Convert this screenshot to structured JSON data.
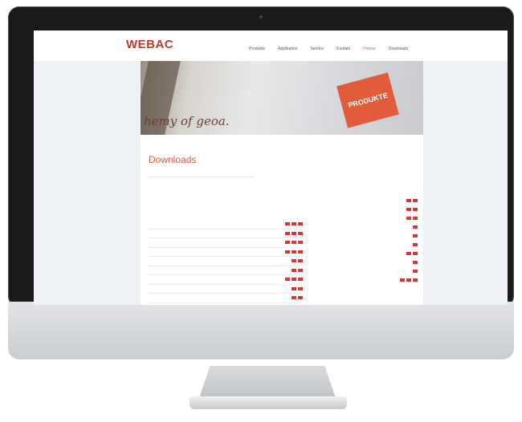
{
  "site": {
    "brand": "WEBAC",
    "brand_sub": "",
    "utility": "",
    "nav": [
      "Produkte",
      "Applikation",
      "Service",
      "Kontakt",
      "Presse",
      "Downloads"
    ],
    "nav_active_index": 4
  },
  "hero": {
    "script_text": "hemy of geoa.",
    "stamp_label": "PRODUKTE"
  },
  "breadcrumb": "",
  "page": {
    "title": "Downloads",
    "search_placeholder": ""
  },
  "section": {
    "title": "",
    "description": "",
    "subtitle": ""
  },
  "downloads": [
    {
      "label": "",
      "flags": 3
    },
    {
      "label": "",
      "flags": 3
    },
    {
      "label": "",
      "flags": 3
    },
    {
      "label": "",
      "flags": 3
    },
    {
      "label": "",
      "flags": 2
    },
    {
      "label": "",
      "flags": 2
    },
    {
      "label": "",
      "flags": 3
    },
    {
      "label": "",
      "flags": 2
    },
    {
      "label": "",
      "flags": 2
    }
  ],
  "sidebar": {
    "title": "",
    "items": [
      {
        "label": "",
        "flags": 2
      },
      {
        "label": "",
        "flags": 2
      },
      {
        "label": "",
        "flags": 2
      },
      {
        "label": "",
        "flags": 1
      },
      {
        "label": "",
        "flags": 1
      },
      {
        "label": "",
        "flags": 1
      },
      {
        "label": "",
        "flags": 2
      },
      {
        "label": "",
        "flags": 1
      },
      {
        "label": "",
        "flags": 1
      },
      {
        "label": "",
        "flags": 3
      }
    ]
  },
  "colors": {
    "accent": "#e05a3a",
    "brand": "#c0392b",
    "flag": "#dd3333"
  }
}
